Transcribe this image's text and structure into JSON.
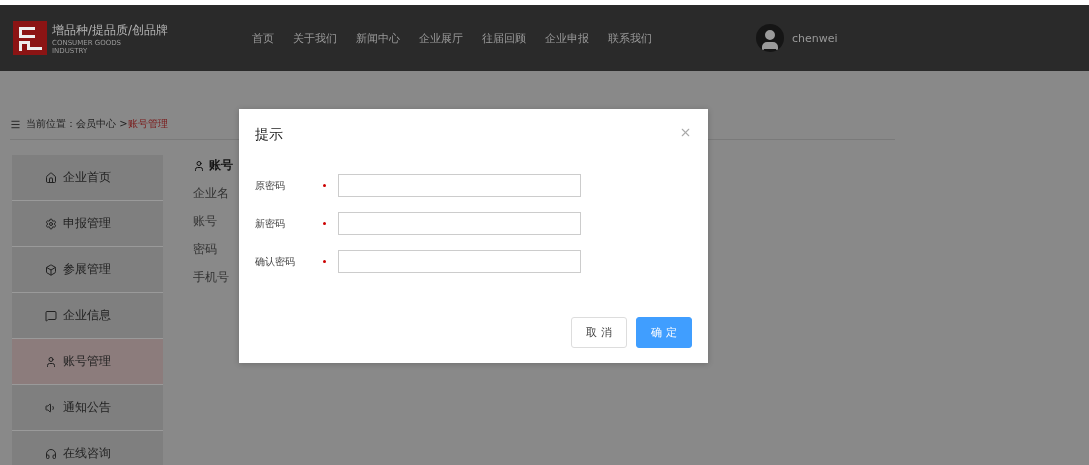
{
  "logo": {
    "slogan": "增品种/提品质/创品牌",
    "subtitle_1": "CONSUMER GOODS",
    "subtitle_2": "INDUSTRY"
  },
  "nav": [
    "首页",
    "关于我们",
    "新闻中心",
    "企业展厅",
    "往届回顾",
    "企业申报",
    "联系我们"
  ],
  "user": {
    "name": "chenwei"
  },
  "breadcrumb": {
    "prefix": "当前位置：会员中心 >",
    "current": "账号管理"
  },
  "sidebar": {
    "items": [
      {
        "label": "企业首页",
        "selected": false
      },
      {
        "label": "申报管理",
        "selected": false
      },
      {
        "label": "参展管理",
        "selected": false
      },
      {
        "label": "企业信息",
        "selected": false
      },
      {
        "label": "账号管理",
        "selected": true
      },
      {
        "label": "通知公告",
        "selected": false
      },
      {
        "label": "在线咨询",
        "selected": false
      }
    ]
  },
  "content": {
    "heading": "账号",
    "fields": [
      "企业名",
      "账号",
      "密码",
      "手机号"
    ]
  },
  "dialog": {
    "title": "提示",
    "fields": [
      {
        "label": "原密码",
        "required": true
      },
      {
        "label": "新密码",
        "required": true
      },
      {
        "label": "确认密码",
        "required": true
      }
    ],
    "buttons": [
      {
        "label": "取 消",
        "kind": "secondary"
      },
      {
        "label": "确 定",
        "kind": "primary"
      }
    ]
  }
}
